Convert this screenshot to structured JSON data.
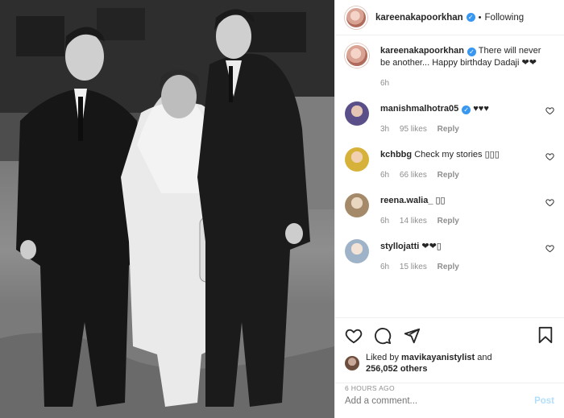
{
  "header": {
    "username": "kareenakapoorkhan",
    "follow_status": "Following"
  },
  "caption": {
    "username": "kareenakapoorkhan",
    "text": "There will never be another... Happy birthday Dadaji ❤❤",
    "time": "6h"
  },
  "comments": [
    {
      "username": "manishmalhotra05",
      "text": "♥♥♥",
      "time": "3h",
      "likes": "95 likes",
      "reply": "Reply",
      "avatar_color": "#5b4f8a"
    },
    {
      "username": "kchbbg",
      "text": "Check my stories ▯▯▯",
      "time": "6h",
      "likes": "66 likes",
      "reply": "Reply",
      "avatar_color": "#d7b23a"
    },
    {
      "username": "reena.walia_",
      "text": "▯▯",
      "time": "6h",
      "likes": "14 likes",
      "reply": "Reply",
      "avatar_color": "#a58a6a"
    },
    {
      "username": "styllojatti",
      "text": "❤❤▯",
      "time": "6h",
      "likes": "15 likes",
      "reply": "Reply",
      "avatar_color": "#9fb3c8"
    }
  ],
  "likes": {
    "prefix": "Liked by",
    "user": "mavikayanistylist",
    "suffix": "and",
    "others": "256,052 others"
  },
  "timestamp": "6 HOURS AGO",
  "add_comment": {
    "placeholder": "Add a comment...",
    "post_label": "Post"
  },
  "colors": {
    "verified": "#3897f0",
    "muted": "#8e8e8e",
    "post_disabled": "#b2dffc"
  },
  "icons": [
    "heart-icon",
    "comment-icon",
    "share-icon",
    "bookmark-icon",
    "verified-icon"
  ]
}
